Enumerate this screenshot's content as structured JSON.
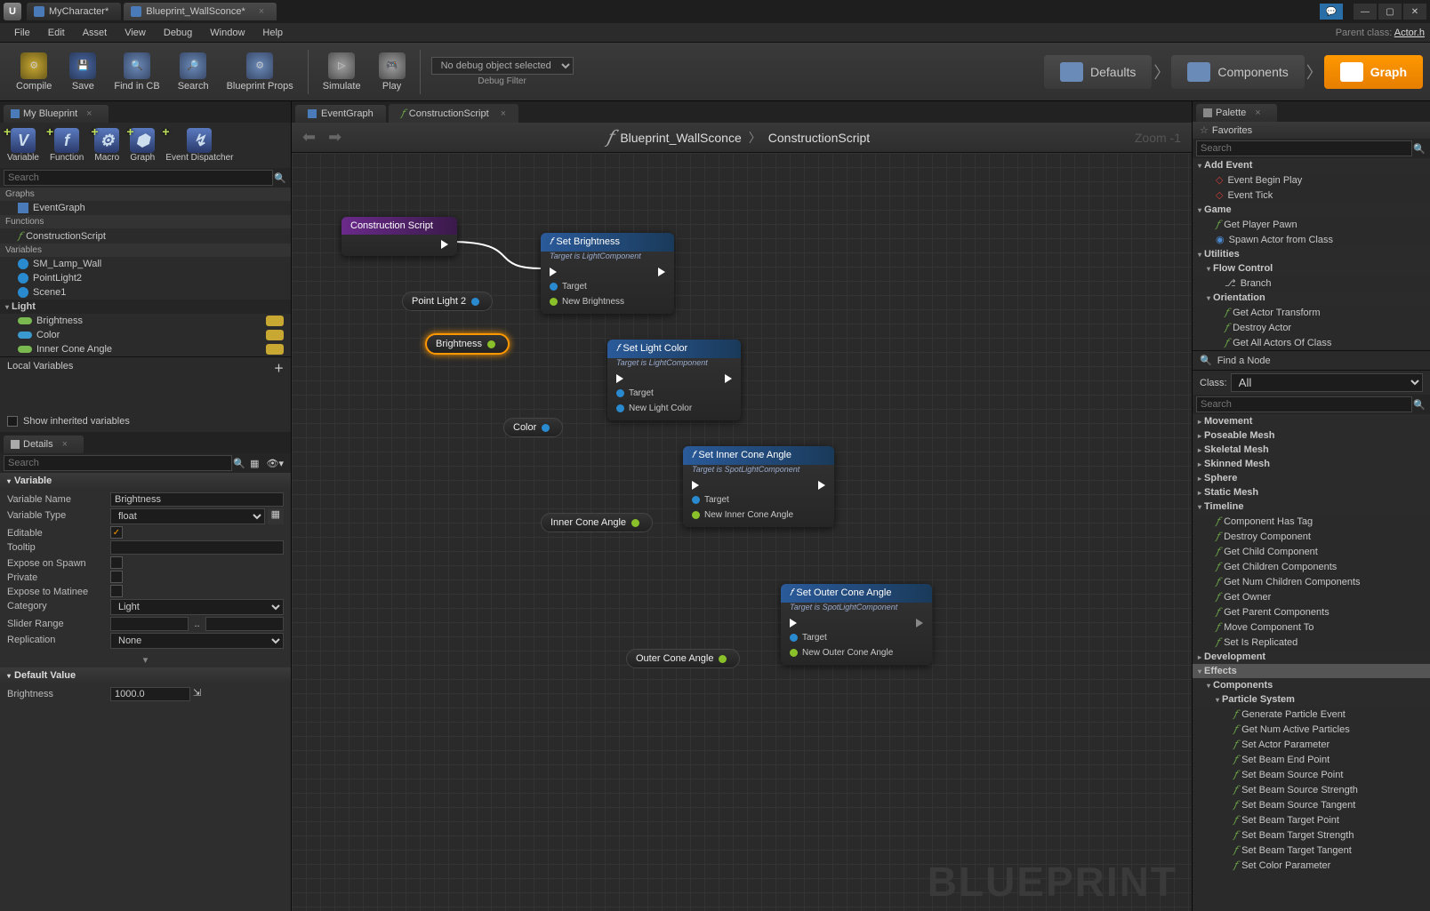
{
  "window_tabs": [
    "MyCharacter*",
    "Blueprint_WallSconce*"
  ],
  "parent_class_label": "Parent class:",
  "parent_class": "Actor.h",
  "menubar": [
    "File",
    "Edit",
    "Asset",
    "View",
    "Debug",
    "Window",
    "Help"
  ],
  "toolbar": {
    "compile": "Compile",
    "save": "Save",
    "findcb": "Find in CB",
    "search": "Search",
    "bpprops": "Blueprint Props",
    "simulate": "Simulate",
    "play": "Play",
    "debug_selected": "No debug object selected",
    "debug_filter": "Debug Filter"
  },
  "mode_tabs": {
    "defaults": "Defaults",
    "components": "Components",
    "graph": "Graph"
  },
  "panels": {
    "mybp": "My Blueprint",
    "details": "Details",
    "palette": "Palette"
  },
  "mybp_toolbar": [
    "Variable",
    "Function",
    "Macro",
    "Graph",
    "Event Dispatcher"
  ],
  "mybp_toolbar_glyphs": [
    "V",
    "f",
    "⚙",
    "⬢",
    "↯"
  ],
  "mybp_search_placeholder": "Search",
  "mybp_tree": {
    "graphs_hdr": "Graphs",
    "eventgraph": "EventGraph",
    "functions_hdr": "Functions",
    "constructionscript": "ConstructionScript",
    "variables_hdr": "Variables",
    "vars": [
      "SM_Lamp_Wall",
      "PointLight2",
      "Scene1"
    ],
    "light_cat": "Light",
    "light_vars": [
      "Brightness",
      "Color",
      "Inner Cone Angle"
    ]
  },
  "local_variables": "Local Variables",
  "show_inherited": "Show inherited variables",
  "details": {
    "search_placeholder": "Search",
    "sec_variable": "Variable",
    "fields": {
      "name_lbl": "Variable Name",
      "name_val": "Brightness",
      "type_lbl": "Variable Type",
      "type_val": "float",
      "editable_lbl": "Editable",
      "editable_val": true,
      "tooltip_lbl": "Tooltip",
      "tooltip_val": "",
      "expose_spawn_lbl": "Expose on Spawn",
      "expose_spawn_val": false,
      "private_lbl": "Private",
      "private_val": false,
      "expose_matinee_lbl": "Expose to Matinee",
      "expose_matinee_val": false,
      "category_lbl": "Category",
      "category_val": "Light",
      "slider_lbl": "Slider Range",
      "slider_min": "",
      "slider_max": "",
      "replication_lbl": "Replication",
      "replication_val": "None"
    },
    "sec_default": "Default Value",
    "default_lbl": "Brightness",
    "default_val": "1000.0"
  },
  "center": {
    "tabs": [
      "EventGraph",
      "ConstructionScript"
    ],
    "breadcrumb": [
      "Blueprint_WallSconce",
      "ConstructionScript"
    ],
    "zoom": "Zoom -1",
    "watermark": "BLUEPRINT"
  },
  "nodes": {
    "construction": {
      "title": "Construction Script"
    },
    "set_brightness": {
      "title": "Set Brightness",
      "sub": "Target is LightComponent",
      "target": "Target",
      "inp": "New Brightness"
    },
    "set_lightcolor": {
      "title": "Set Light Color",
      "sub": "Target is LightComponent",
      "target": "Target",
      "inp": "New Light Color"
    },
    "set_inner": {
      "title": "Set Inner Cone Angle",
      "sub": "Target is SpotLightComponent",
      "target": "Target",
      "inp": "New Inner Cone Angle"
    },
    "set_outer": {
      "title": "Set Outer Cone Angle",
      "sub": "Target is SpotLightComponent",
      "target": "Target",
      "inp": "New Outer Cone Angle"
    },
    "var_pointlight": "Point Light 2",
    "var_brightness": "Brightness",
    "var_color": "Color",
    "var_inner": "Inner Cone Angle",
    "var_outer": "Outer Cone Angle"
  },
  "palette": {
    "favorites": "Favorites",
    "search_placeholder": "Search",
    "addevent": "Add Event",
    "addevent_items": [
      "Event Begin Play",
      "Event Tick"
    ],
    "game": "Game",
    "game_items": [
      "Get Player Pawn",
      "Spawn Actor from Class"
    ],
    "utilities": "Utilities",
    "flowcontrol": "Flow Control",
    "branch": "Branch",
    "orientation": "Orientation",
    "orientation_items": [
      "Get Actor Transform",
      "Destroy Actor",
      "Get All Actors Of Class"
    ],
    "find_node": "Find a Node",
    "class_lbl": "Class:",
    "class_val": "All",
    "lib_cats": [
      "Movement",
      "Poseable Mesh",
      "Skeletal Mesh",
      "Skinned Mesh",
      "Sphere",
      "Static Mesh",
      "Timeline"
    ],
    "timeline_items": [
      "Component Has Tag",
      "Destroy Component",
      "Get Child Component",
      "Get Children Components",
      "Get Num Children Components",
      "Get Owner",
      "Get Parent Components",
      "Move Component To",
      "Set Is Replicated"
    ],
    "dev": "Development",
    "effects": "Effects",
    "effects_sub": "Components",
    "particle": "Particle System",
    "particle_items": [
      "Generate Particle Event",
      "Get Num Active Particles",
      "Set Actor Parameter",
      "Set Beam End Point",
      "Set Beam Source Point",
      "Set Beam Source Strength",
      "Set Beam Source Tangent",
      "Set Beam Target Point",
      "Set Beam Target Strength",
      "Set Beam Target Tangent",
      "Set Color Parameter"
    ]
  }
}
